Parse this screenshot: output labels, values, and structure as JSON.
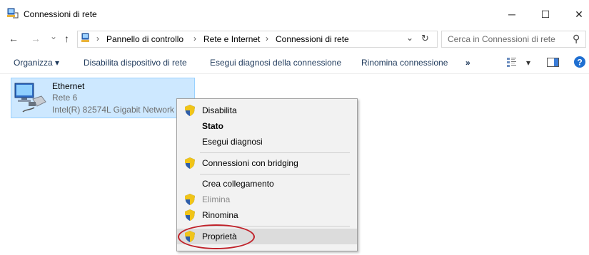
{
  "window": {
    "title": "Connessioni di rete",
    "minimize_glyph": "─",
    "maximize_glyph": "☐",
    "close_glyph": "✕"
  },
  "navigation": {
    "back_glyph": "←",
    "forward_glyph": "→",
    "recent_glyph": "⌄",
    "up_glyph": "↑"
  },
  "address": {
    "breadcrumb": [
      "Pannello di controllo",
      "Rete e Internet",
      "Connessioni di rete"
    ],
    "separator": "›",
    "dropdown_glyph": "⌄",
    "refresh_glyph": "↻"
  },
  "search": {
    "placeholder": "Cerca in Connessioni di rete",
    "icon_glyph": "⚲"
  },
  "toolbar": {
    "organize_label": "Organizza ▾",
    "items": [
      "Disabilita dispositivo di rete",
      "Esegui diagnosi della connessione",
      "Rinomina connessione"
    ],
    "overflow_label": "»",
    "view_dropdown_glyph": "▾",
    "help_glyph": "?"
  },
  "connection": {
    "name": "Ethernet",
    "network": "Rete 6",
    "adapter": "Intel(R) 82574L Gigabit Network"
  },
  "context_menu": {
    "items": [
      {
        "label": "Disabilita",
        "shield": true,
        "style": "normal"
      },
      {
        "label": "Stato",
        "shield": false,
        "style": "bold"
      },
      {
        "label": "Esegui diagnosi",
        "shield": false,
        "style": "normal"
      },
      {
        "label": "Connessioni con bridging",
        "shield": true,
        "style": "normal"
      },
      {
        "label": "Crea collegamento",
        "shield": false,
        "style": "normal"
      },
      {
        "label": "Elimina",
        "shield": true,
        "style": "disabled"
      },
      {
        "label": "Rinomina",
        "shield": true,
        "style": "normal"
      },
      {
        "label": "Proprietà",
        "shield": true,
        "style": "highlighted"
      }
    ]
  },
  "colors": {
    "selection_bg": "#cde8ff",
    "selection_border": "#99d1ff",
    "menu_bg": "#f2f2f2",
    "highlight_ellipse": "#c0222a",
    "help_blue": "#1f6fd1"
  }
}
